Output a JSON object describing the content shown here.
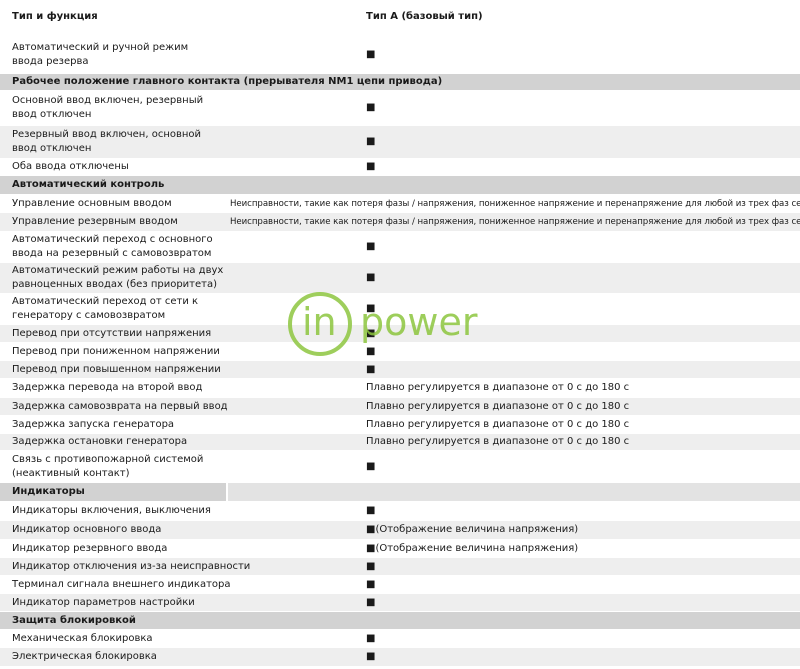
{
  "header": {
    "col1": "Тип и функция",
    "col2": "Тип А (базовый тип)"
  },
  "bullet": "■",
  "rows": [
    {
      "type": "item",
      "label": [
        "Автоматический и ручной режим",
        "ввода резерва"
      ],
      "value": "■"
    },
    {
      "type": "section",
      "label": "Рабочее положение главного контакта (прерывателя NM1 цепи привода)"
    },
    {
      "type": "item",
      "label": [
        "Основной ввод включен, резервный",
        "ввод отключен"
      ],
      "value": "■"
    },
    {
      "type": "item",
      "label": [
        "Резервный ввод включен, основной",
        "ввод отключен"
      ],
      "value": "■"
    },
    {
      "type": "item",
      "label": [
        "Оба ввода отключены"
      ],
      "value": "■"
    },
    {
      "type": "section",
      "label": "Автоматический контроль"
    },
    {
      "type": "item",
      "label": [
        "Управление основным вводом"
      ],
      "value": "Неисправности, такие как потеря фазы / напряжения, пониженное напряжение и перенапряжение для любой из трех фаз сети",
      "long": true
    },
    {
      "type": "item",
      "label": [
        "Управление резервным вводом"
      ],
      "value": "Неисправности, такие как потеря фазы / напряжения, пониженное напряжение и перенапряжение для любой из трех фаз сети",
      "long": true
    },
    {
      "type": "item",
      "label": [
        "Автоматический переход с основного",
        "ввода на резервный с самовозвратом"
      ],
      "value": "■"
    },
    {
      "type": "item",
      "label": [
        "Автоматический режим работы на двух",
        "равноценных вводах (без приоритета)"
      ],
      "value": "■"
    },
    {
      "type": "item",
      "label": [
        "Автоматический переход от сети к",
        "генератору с самовозвратом"
      ],
      "value": "■"
    },
    {
      "type": "item",
      "label": [
        "Перевод при отсутствии напряжения"
      ],
      "value": "■"
    },
    {
      "type": "item",
      "label": [
        "Перевод при пониженном напряжении"
      ],
      "value": "■"
    },
    {
      "type": "item",
      "label": [
        "Перевод при повышенном напряжении"
      ],
      "value": "■"
    },
    {
      "type": "item",
      "label": [
        "Задержка перевода на второй ввод"
      ],
      "value": "Плавно регулируется в диапазоне от 0 с до 180 с"
    },
    {
      "type": "item",
      "label": [
        "Задержка самовозврата на первый ввод"
      ],
      "value": "Плавно регулируется в диапазоне от 0 с до 180 с"
    },
    {
      "type": "item",
      "label": [
        "Задержка запуска генератора"
      ],
      "value": "Плавно регулируется в диапазоне от 0 с до 180 с"
    },
    {
      "type": "item",
      "label": [
        "Задержка остановки генератора"
      ],
      "value": "Плавно регулируется в диапазоне от 0 с до 180 с"
    },
    {
      "type": "item",
      "label": [
        "Связь с противопожарной системой",
        "(неактивный контакт)"
      ],
      "value": "■"
    },
    {
      "type": "section",
      "label": "Индикаторы",
      "split": true
    },
    {
      "type": "item",
      "label": [
        "Индикаторы включения, выключения"
      ],
      "value": "■"
    },
    {
      "type": "item",
      "label": [
        "Индикатор основного ввода"
      ],
      "value": "■(Отображение величина напряжения)"
    },
    {
      "type": "item",
      "label": [
        "Индикатор резервного ввода"
      ],
      "value": "■(Отображение величина напряжения)"
    },
    {
      "type": "item",
      "label": [
        "Индикатор отключения из-за неисправности"
      ],
      "value": "■"
    },
    {
      "type": "item",
      "label": [
        "Терминал сигнала внешнего индикатора"
      ],
      "value": "■"
    },
    {
      "type": "item",
      "label": [
        "Индикатор параметров настройки"
      ],
      "value": "■"
    },
    {
      "type": "section",
      "label": "Защита блокировкой"
    },
    {
      "type": "item",
      "label": [
        "Механическая блокировка"
      ],
      "value": "■"
    },
    {
      "type": "item",
      "label": [
        "Электрическая блокировка"
      ],
      "value": "■"
    }
  ],
  "watermark": {
    "left": "in",
    "right": "power",
    "color": "#8dc63f"
  }
}
